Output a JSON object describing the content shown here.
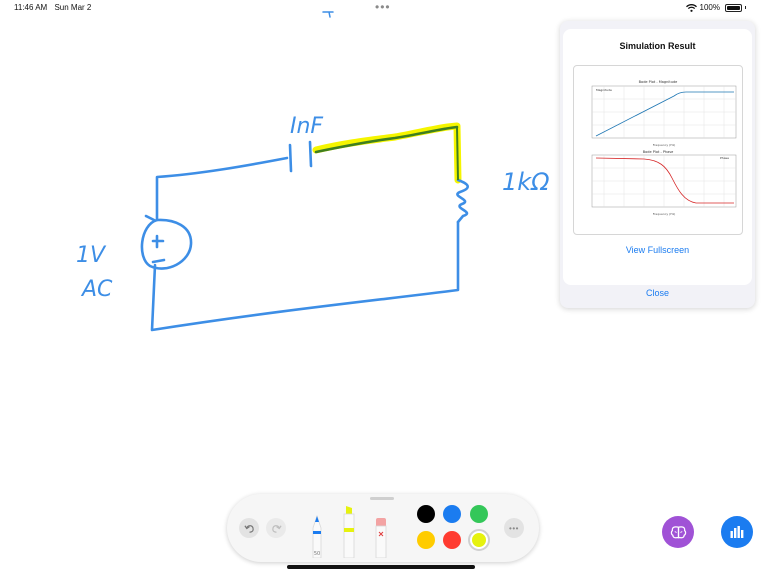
{
  "status_bar": {
    "time": "11:46 AM",
    "date": "Sun Mar 2",
    "dots": "•••",
    "battery_text": "100%",
    "icons": [
      "wifi-icon",
      "battery-icon"
    ]
  },
  "handwriting": {
    "capacitor_label": "InF",
    "resistor_label": "1kΩ",
    "source_label_1": "1V",
    "source_label_2": "AC",
    "source_plus": "+",
    "source_minus": "−",
    "top_mark": "ᐪ"
  },
  "simulation_panel": {
    "title": "Simulation Result",
    "view_fullscreen": "View Fullscreen",
    "close": "Close",
    "plot_top_title": "Bode Plot - Magnitude",
    "plot_bottom_title": "Bode Plot - Phase",
    "plot_top_legend": "Magnitude",
    "plot_bottom_legend": "Phase",
    "plot_x_label": "Frequency (Hz)"
  },
  "toolbar": {
    "undo_icon": "undo-icon",
    "redo_icon": "redo-icon",
    "more_label": "•••",
    "pen_size": "50",
    "colors": [
      "#000000",
      "#1b7cf0",
      "#34c759",
      "#ffcc00",
      "#ff3b30",
      "#e6f20f"
    ],
    "selected_color": "#e6f20f"
  },
  "floating_buttons": {
    "brain_color": "#a052d6",
    "chart_color": "#1b7cf0",
    "icons": [
      "brain-icon",
      "chart-icon"
    ]
  },
  "colors": {
    "ink_blue": "#3d8ee6",
    "highlight_yellow": "#f5f500",
    "ink_green": "#3f7f1f",
    "accent": "#1b7cf0"
  }
}
